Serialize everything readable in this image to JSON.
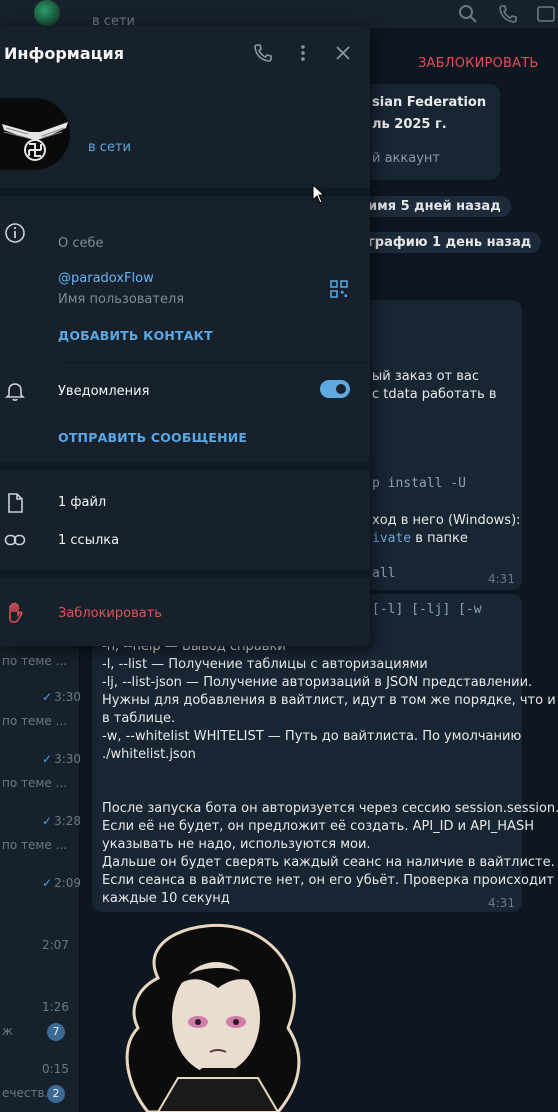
{
  "header": {
    "status": "в сети",
    "block_button": "ЗАБЛОКИРОВАТЬ"
  },
  "panel": {
    "title": "Информация",
    "status": "в сети",
    "about_label": "О себе",
    "username": "@paradoxFlow",
    "username_label": "Имя пользователя",
    "add_contact": "ДОБАВИТЬ КОНТАКТ",
    "notifications_label": "Уведомления",
    "notifications_on": true,
    "send_message": "ОТПРАВИТЬ СООБЩЕНИЕ",
    "files": "1 файл",
    "links": "1 ссылка",
    "block": "Заблокировать"
  },
  "chat": {
    "card_line1": "sian Federation",
    "card_line2": "ль 2025 г.",
    "card_line3": "й аккаунт",
    "service1": "имя 5 дней назад",
    "service2": "графию 1 день назад",
    "msg1_line1": "ый заказ от вас",
    "msg1_line2": "с tdata работать в",
    "msg1_code1": "p install -U",
    "msg1_line3": "ход в него (Windows):",
    "msg1_code2": "ivate",
    "msg1_line3b": "в папке",
    "msg1_code3": "all",
    "msg1_time": "4:31",
    "msg2_code": "[-l] [-lj] [-w",
    "msg2_lines": [
      "-h, --help — Вывод справки",
      "-l, --list — Получение таблицы с авторизациями",
      "-lj, --list-json — Получение авторизаций в JSON представлении.",
      "Нужны для добавления в вайтлист, идут в том же порядке, что и",
      "в таблице.",
      "-w, --whitelist WHITELIST — Путь до вайтлиста. По умолчанию",
      "./whitelist.json",
      "",
      "",
      "После запуска бота он авторизуется через сессию session.session.",
      "Если её не будет, он предложит её создать. API_ID и API_HASH",
      "указывать не надо, используются мои.",
      "Дальше он будет сверять каждый сеанс на наличие в вайтлисте.",
      "Если сеанса в вайтлисте нет, он его убьёт. Проверка происходит",
      "каждые 10 секунд"
    ],
    "msg2_time": "4:31"
  },
  "chat_list": [
    {
      "snippet": "по теме ...",
      "time": ""
    },
    {
      "snippet": "",
      "time": "3:30",
      "read": true
    },
    {
      "snippet": "по теме ...",
      "time": ""
    },
    {
      "snippet": "",
      "time": "3:30",
      "read": true
    },
    {
      "snippet": "по теме ...",
      "time": ""
    },
    {
      "snippet": "",
      "time": "3:28",
      "read": true
    },
    {
      "snippet": "по теме ...",
      "time": ""
    },
    {
      "snippet": "",
      "time": "2:09",
      "read": true
    },
    {
      "snippet": "",
      "time": "2:07"
    },
    {
      "snippet": "",
      "time": "1:26"
    },
    {
      "snippet": "ж",
      "badge": "7"
    },
    {
      "snippet": "",
      "time": "0:15"
    },
    {
      "snippet": "ечеств...",
      "badge": "2"
    }
  ],
  "colors": {
    "accent": "#5fa8e0",
    "danger": "#e0505c",
    "panel_bg": "#17212b",
    "chat_bg": "#0e1621"
  }
}
